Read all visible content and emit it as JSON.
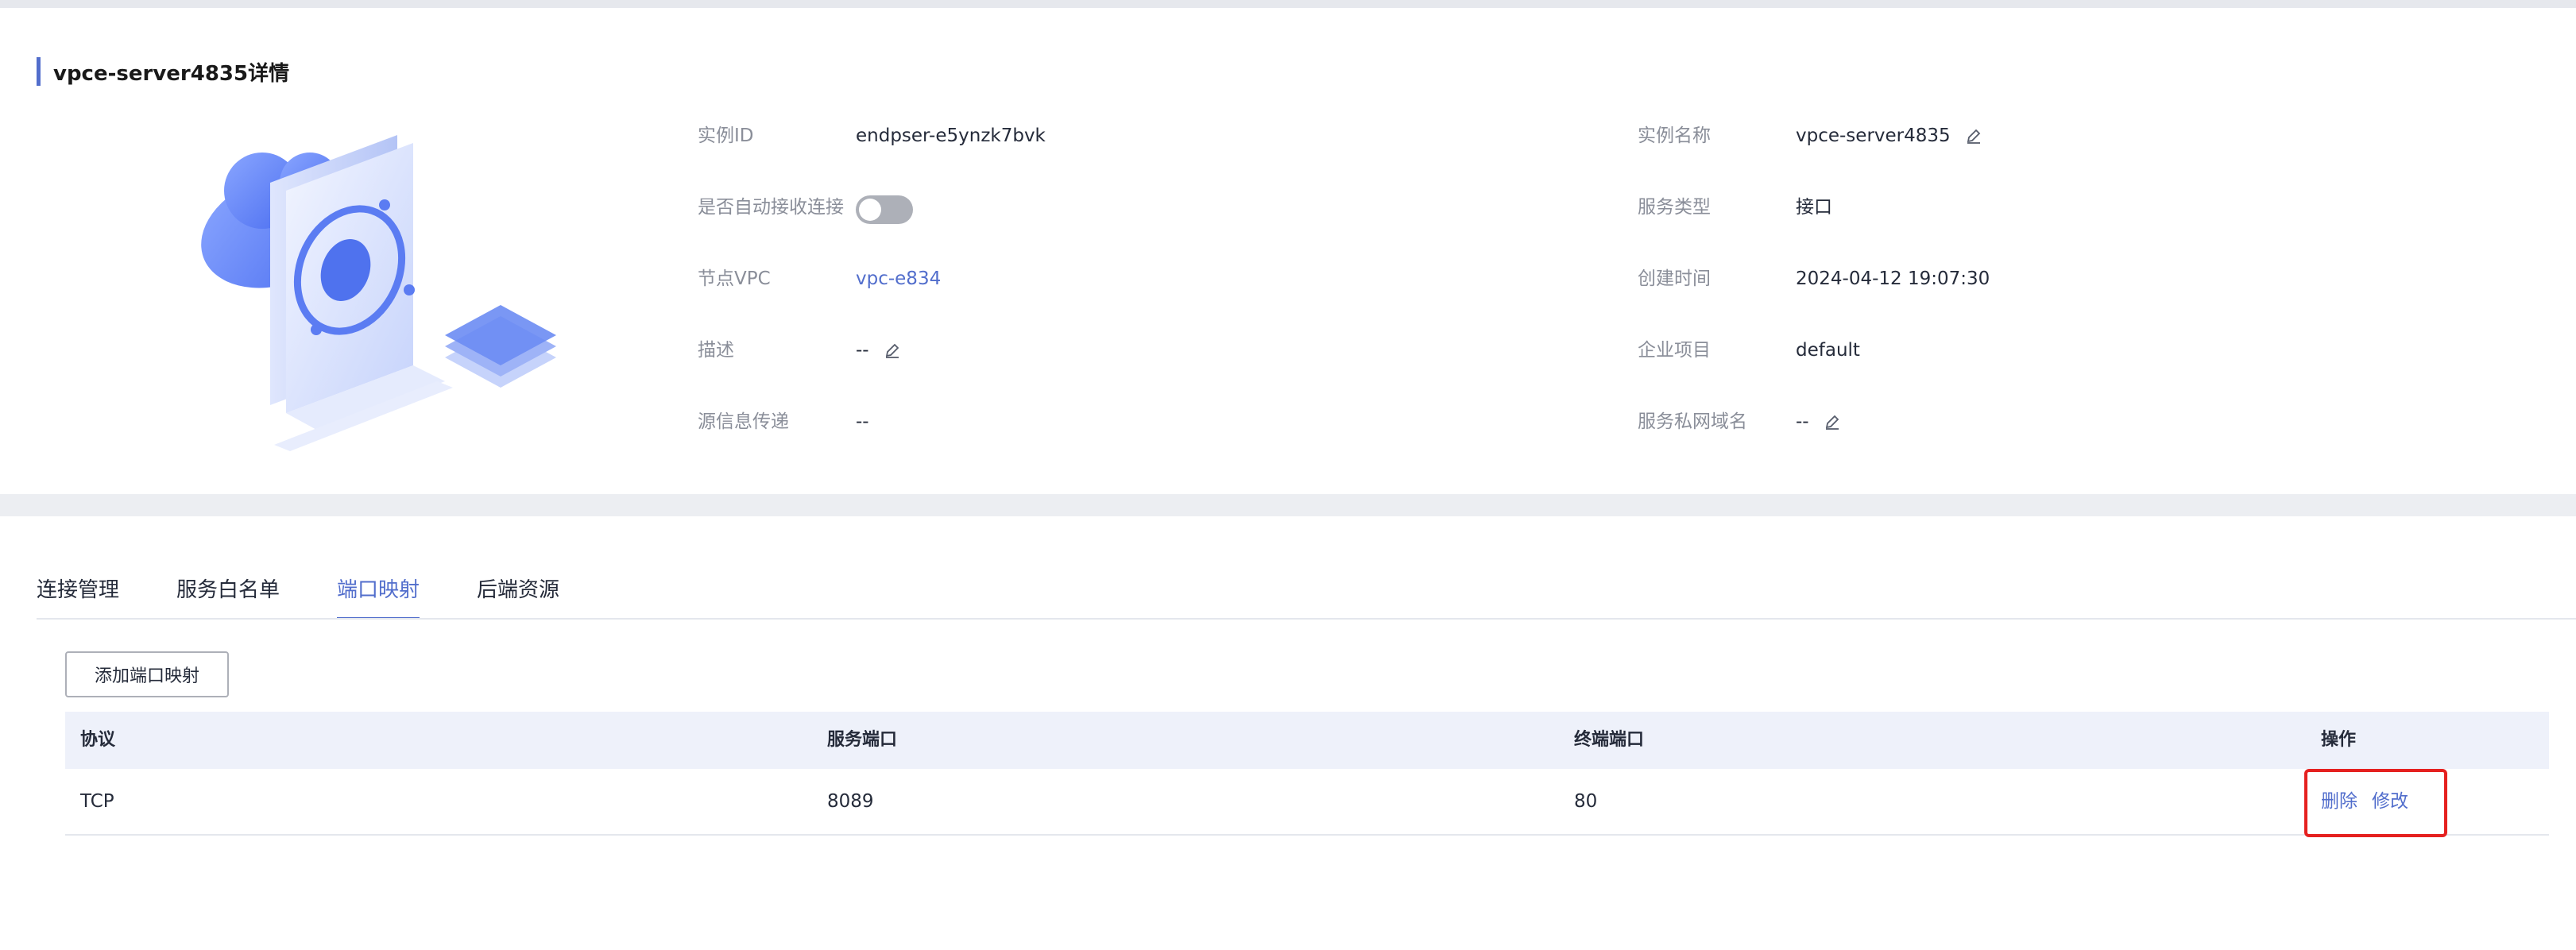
{
  "page": {
    "title": "vpce-server4835详情"
  },
  "info": {
    "left": [
      {
        "label": "实例ID",
        "value": "endpser-e5ynzk7bvk"
      },
      {
        "label": "是否自动接收连接",
        "toggle_on": false
      },
      {
        "label": "节点VPC",
        "value": "vpc-e834"
      },
      {
        "label": "描述",
        "value": "--"
      },
      {
        "label": "源信息传递",
        "value": "--"
      }
    ],
    "right": [
      {
        "label": "实例名称",
        "value": "vpce-server4835"
      },
      {
        "label": "服务类型",
        "value": "接口"
      },
      {
        "label": "创建时间",
        "value": "2024-04-12 19:07:30"
      },
      {
        "label": "企业项目",
        "value": "default"
      },
      {
        "label": "服务私网域名",
        "value": "--"
      }
    ]
  },
  "tabs": [
    {
      "label": "连接管理",
      "active": false
    },
    {
      "label": "服务白名单",
      "active": false
    },
    {
      "label": "端口映射",
      "active": true
    },
    {
      "label": "后端资源",
      "active": false
    }
  ],
  "actions": {
    "add_label": "添加端口映射"
  },
  "table": {
    "headers": [
      "协议",
      "服务端口",
      "终端端口",
      "操作"
    ],
    "rows": [
      {
        "protocol": "TCP",
        "service_port": "8089",
        "terminal_port": "80",
        "op_delete": "删除",
        "op_modify": "修改"
      }
    ]
  },
  "colors": {
    "accent": "#526ecc",
    "highlight": "#e5201f"
  }
}
